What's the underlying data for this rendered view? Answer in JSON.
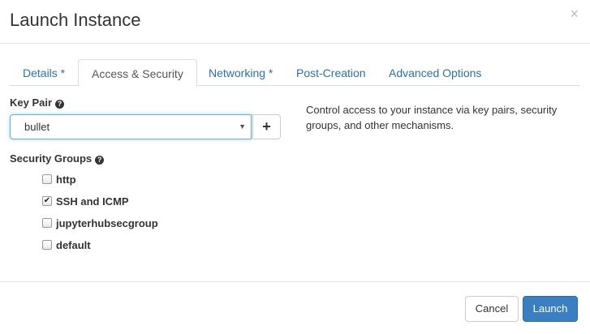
{
  "dialog": {
    "title": "Launch Instance",
    "close_glyph": "×"
  },
  "tabs": [
    {
      "label": "Details *",
      "active": false
    },
    {
      "label": "Access & Security",
      "active": true
    },
    {
      "label": "Networking *",
      "active": false
    },
    {
      "label": "Post-Creation",
      "active": false
    },
    {
      "label": "Advanced Options",
      "active": false
    }
  ],
  "key_pair": {
    "label": "Key Pair",
    "selected": "bullet",
    "add_glyph": "+"
  },
  "help_text": "Control access to your instance via key pairs, security groups, and other mechanisms.",
  "security_groups": {
    "label": "Security Groups",
    "items": [
      {
        "label": "http",
        "checked": false
      },
      {
        "label": "SSH and ICMP",
        "checked": true
      },
      {
        "label": "jupyterhubsecgroup",
        "checked": false
      },
      {
        "label": "default",
        "checked": false
      }
    ]
  },
  "footer": {
    "cancel_label": "Cancel",
    "launch_label": "Launch"
  },
  "colors": {
    "link": "#2a6fb8",
    "primary": "#3a7fc1",
    "focus_border": "#66afe9"
  },
  "icons": {
    "help": "question-circle-icon",
    "close": "close-icon",
    "caret": "caret-down-icon",
    "add": "plus-icon",
    "check": "check-icon"
  }
}
